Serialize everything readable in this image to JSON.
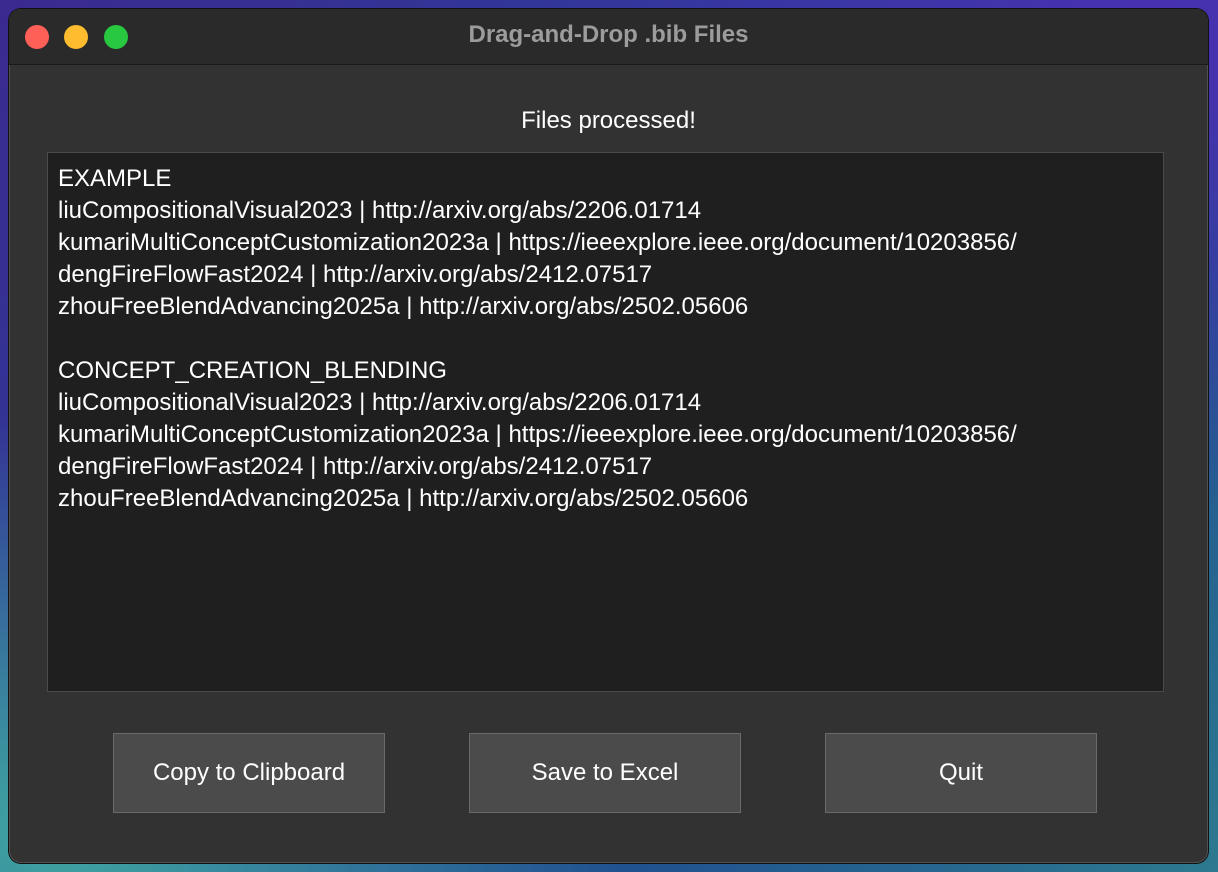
{
  "window": {
    "title": "Drag-and-Drop .bib Files"
  },
  "status": {
    "message": "Files processed!"
  },
  "output": {
    "lines": [
      "EXAMPLE",
      "liuCompositionalVisual2023 | http://arxiv.org/abs/2206.01714",
      "kumariMultiConceptCustomization2023a | https://ieeexplore.ieee.org/document/10203856/",
      "dengFireFlowFast2024 | http://arxiv.org/abs/2412.07517",
      "zhouFreeBlendAdvancing2025a | http://arxiv.org/abs/2502.05606",
      "",
      "CONCEPT_CREATION_BLENDING",
      "liuCompositionalVisual2023 | http://arxiv.org/abs/2206.01714",
      "kumariMultiConceptCustomization2023a | https://ieeexplore.ieee.org/document/10203856/",
      "dengFireFlowFast2024 | http://arxiv.org/abs/2412.07517",
      "zhouFreeBlendAdvancing2025a | http://arxiv.org/abs/2502.05606"
    ]
  },
  "buttons": {
    "copy_label": "Copy to Clipboard",
    "save_label": "Save to Excel",
    "quit_label": "Quit"
  },
  "colors": {
    "close": "#fe5f57",
    "minimize": "#febc2e",
    "maximize": "#28c840"
  }
}
